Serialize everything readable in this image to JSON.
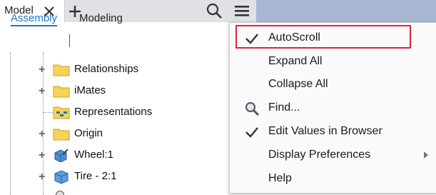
{
  "tab": {
    "title": "Model"
  },
  "subtabs": {
    "assembly": "Assembly",
    "modeling": "Modeling"
  },
  "tree": [
    {
      "label": "Relationships",
      "icon": "folder-icon",
      "expandable": true
    },
    {
      "label": "iMates",
      "icon": "folder-icon",
      "expandable": true
    },
    {
      "label": "Representations",
      "icon": "representations-icon",
      "expandable": false
    },
    {
      "label": "Origin",
      "icon": "folder-icon",
      "expandable": true
    },
    {
      "label": "Wheel:1",
      "icon": "assembly-part-icon",
      "expandable": true
    },
    {
      "label": "Tire - 2:1",
      "icon": "part-cube-icon",
      "expandable": true
    }
  ],
  "menu": {
    "items": [
      {
        "label": "AutoScroll",
        "checked": true,
        "submenu": false,
        "highlighted": true
      },
      {
        "label": "Expand All",
        "checked": false,
        "submenu": false
      },
      {
        "label": "Collapse All",
        "checked": false,
        "submenu": false
      },
      {
        "label": "Find...",
        "icon": "magnifier-icon",
        "submenu": false
      },
      {
        "label": "Edit Values in Browser",
        "checked": true,
        "submenu": false
      },
      {
        "label": "Display Preferences",
        "checked": false,
        "submenu": true
      },
      {
        "label": "Help",
        "checked": false,
        "submenu": false
      }
    ]
  },
  "colors": {
    "accent": "#1a74c9",
    "highlight_border": "#e0223f",
    "header_blue": "#a9b7d3",
    "folder": "#f7d358"
  }
}
